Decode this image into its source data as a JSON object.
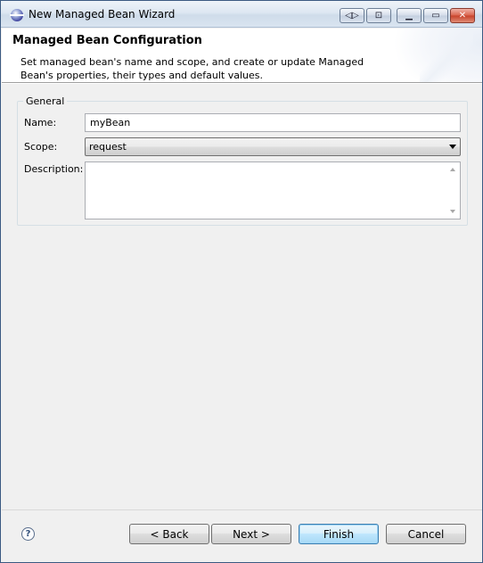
{
  "window": {
    "title": "New Managed Bean Wizard",
    "title_buttons": {
      "nav_a": "◁▷",
      "nav_b": "⊡",
      "minimize": "▁",
      "maximize": "▭",
      "close": "✕"
    }
  },
  "header": {
    "title": "Managed Bean Configuration",
    "description": "Set managed bean's name and scope, and create or update Managed Bean's properties, their types and default values."
  },
  "general_group": {
    "legend": "General",
    "name_label": "Name:",
    "name_value": "myBean",
    "scope_label": "Scope:",
    "scope_value": "request",
    "description_label": "Description:",
    "description_value": ""
  },
  "footer": {
    "help_icon_glyph": "?",
    "back_label": "< Back",
    "next_label": "Next >",
    "finish_label": "Finish",
    "cancel_label": "Cancel"
  },
  "colors": {
    "accent": "#3c7fb1",
    "window_bg": "#f0f0f0"
  }
}
